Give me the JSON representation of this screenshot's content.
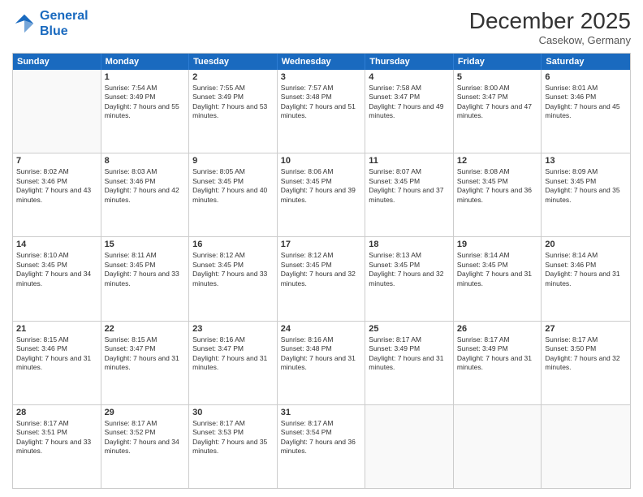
{
  "logo": {
    "line1": "General",
    "line2": "Blue"
  },
  "title": "December 2025",
  "location": "Casekow, Germany",
  "header_days": [
    "Sunday",
    "Monday",
    "Tuesday",
    "Wednesday",
    "Thursday",
    "Friday",
    "Saturday"
  ],
  "weeks": [
    [
      {
        "day": "",
        "sunrise": "",
        "sunset": "",
        "daylight": "",
        "empty": true
      },
      {
        "day": "1",
        "sunrise": "Sunrise: 7:54 AM",
        "sunset": "Sunset: 3:49 PM",
        "daylight": "Daylight: 7 hours and 55 minutes."
      },
      {
        "day": "2",
        "sunrise": "Sunrise: 7:55 AM",
        "sunset": "Sunset: 3:49 PM",
        "daylight": "Daylight: 7 hours and 53 minutes."
      },
      {
        "day": "3",
        "sunrise": "Sunrise: 7:57 AM",
        "sunset": "Sunset: 3:48 PM",
        "daylight": "Daylight: 7 hours and 51 minutes."
      },
      {
        "day": "4",
        "sunrise": "Sunrise: 7:58 AM",
        "sunset": "Sunset: 3:47 PM",
        "daylight": "Daylight: 7 hours and 49 minutes."
      },
      {
        "day": "5",
        "sunrise": "Sunrise: 8:00 AM",
        "sunset": "Sunset: 3:47 PM",
        "daylight": "Daylight: 7 hours and 47 minutes."
      },
      {
        "day": "6",
        "sunrise": "Sunrise: 8:01 AM",
        "sunset": "Sunset: 3:46 PM",
        "daylight": "Daylight: 7 hours and 45 minutes."
      }
    ],
    [
      {
        "day": "7",
        "sunrise": "Sunrise: 8:02 AM",
        "sunset": "Sunset: 3:46 PM",
        "daylight": "Daylight: 7 hours and 43 minutes."
      },
      {
        "day": "8",
        "sunrise": "Sunrise: 8:03 AM",
        "sunset": "Sunset: 3:46 PM",
        "daylight": "Daylight: 7 hours and 42 minutes."
      },
      {
        "day": "9",
        "sunrise": "Sunrise: 8:05 AM",
        "sunset": "Sunset: 3:45 PM",
        "daylight": "Daylight: 7 hours and 40 minutes."
      },
      {
        "day": "10",
        "sunrise": "Sunrise: 8:06 AM",
        "sunset": "Sunset: 3:45 PM",
        "daylight": "Daylight: 7 hours and 39 minutes."
      },
      {
        "day": "11",
        "sunrise": "Sunrise: 8:07 AM",
        "sunset": "Sunset: 3:45 PM",
        "daylight": "Daylight: 7 hours and 37 minutes."
      },
      {
        "day": "12",
        "sunrise": "Sunrise: 8:08 AM",
        "sunset": "Sunset: 3:45 PM",
        "daylight": "Daylight: 7 hours and 36 minutes."
      },
      {
        "day": "13",
        "sunrise": "Sunrise: 8:09 AM",
        "sunset": "Sunset: 3:45 PM",
        "daylight": "Daylight: 7 hours and 35 minutes."
      }
    ],
    [
      {
        "day": "14",
        "sunrise": "Sunrise: 8:10 AM",
        "sunset": "Sunset: 3:45 PM",
        "daylight": "Daylight: 7 hours and 34 minutes."
      },
      {
        "day": "15",
        "sunrise": "Sunrise: 8:11 AM",
        "sunset": "Sunset: 3:45 PM",
        "daylight": "Daylight: 7 hours and 33 minutes."
      },
      {
        "day": "16",
        "sunrise": "Sunrise: 8:12 AM",
        "sunset": "Sunset: 3:45 PM",
        "daylight": "Daylight: 7 hours and 33 minutes."
      },
      {
        "day": "17",
        "sunrise": "Sunrise: 8:12 AM",
        "sunset": "Sunset: 3:45 PM",
        "daylight": "Daylight: 7 hours and 32 minutes."
      },
      {
        "day": "18",
        "sunrise": "Sunrise: 8:13 AM",
        "sunset": "Sunset: 3:45 PM",
        "daylight": "Daylight: 7 hours and 32 minutes."
      },
      {
        "day": "19",
        "sunrise": "Sunrise: 8:14 AM",
        "sunset": "Sunset: 3:45 PM",
        "daylight": "Daylight: 7 hours and 31 minutes."
      },
      {
        "day": "20",
        "sunrise": "Sunrise: 8:14 AM",
        "sunset": "Sunset: 3:46 PM",
        "daylight": "Daylight: 7 hours and 31 minutes."
      }
    ],
    [
      {
        "day": "21",
        "sunrise": "Sunrise: 8:15 AM",
        "sunset": "Sunset: 3:46 PM",
        "daylight": "Daylight: 7 hours and 31 minutes."
      },
      {
        "day": "22",
        "sunrise": "Sunrise: 8:15 AM",
        "sunset": "Sunset: 3:47 PM",
        "daylight": "Daylight: 7 hours and 31 minutes."
      },
      {
        "day": "23",
        "sunrise": "Sunrise: 8:16 AM",
        "sunset": "Sunset: 3:47 PM",
        "daylight": "Daylight: 7 hours and 31 minutes."
      },
      {
        "day": "24",
        "sunrise": "Sunrise: 8:16 AM",
        "sunset": "Sunset: 3:48 PM",
        "daylight": "Daylight: 7 hours and 31 minutes."
      },
      {
        "day": "25",
        "sunrise": "Sunrise: 8:17 AM",
        "sunset": "Sunset: 3:49 PM",
        "daylight": "Daylight: 7 hours and 31 minutes."
      },
      {
        "day": "26",
        "sunrise": "Sunrise: 8:17 AM",
        "sunset": "Sunset: 3:49 PM",
        "daylight": "Daylight: 7 hours and 31 minutes."
      },
      {
        "day": "27",
        "sunrise": "Sunrise: 8:17 AM",
        "sunset": "Sunset: 3:50 PM",
        "daylight": "Daylight: 7 hours and 32 minutes."
      }
    ],
    [
      {
        "day": "28",
        "sunrise": "Sunrise: 8:17 AM",
        "sunset": "Sunset: 3:51 PM",
        "daylight": "Daylight: 7 hours and 33 minutes."
      },
      {
        "day": "29",
        "sunrise": "Sunrise: 8:17 AM",
        "sunset": "Sunset: 3:52 PM",
        "daylight": "Daylight: 7 hours and 34 minutes."
      },
      {
        "day": "30",
        "sunrise": "Sunrise: 8:17 AM",
        "sunset": "Sunset: 3:53 PM",
        "daylight": "Daylight: 7 hours and 35 minutes."
      },
      {
        "day": "31",
        "sunrise": "Sunrise: 8:17 AM",
        "sunset": "Sunset: 3:54 PM",
        "daylight": "Daylight: 7 hours and 36 minutes."
      },
      {
        "day": "",
        "sunrise": "",
        "sunset": "",
        "daylight": "",
        "empty": true
      },
      {
        "day": "",
        "sunrise": "",
        "sunset": "",
        "daylight": "",
        "empty": true
      },
      {
        "day": "",
        "sunrise": "",
        "sunset": "",
        "daylight": "",
        "empty": true
      }
    ]
  ]
}
